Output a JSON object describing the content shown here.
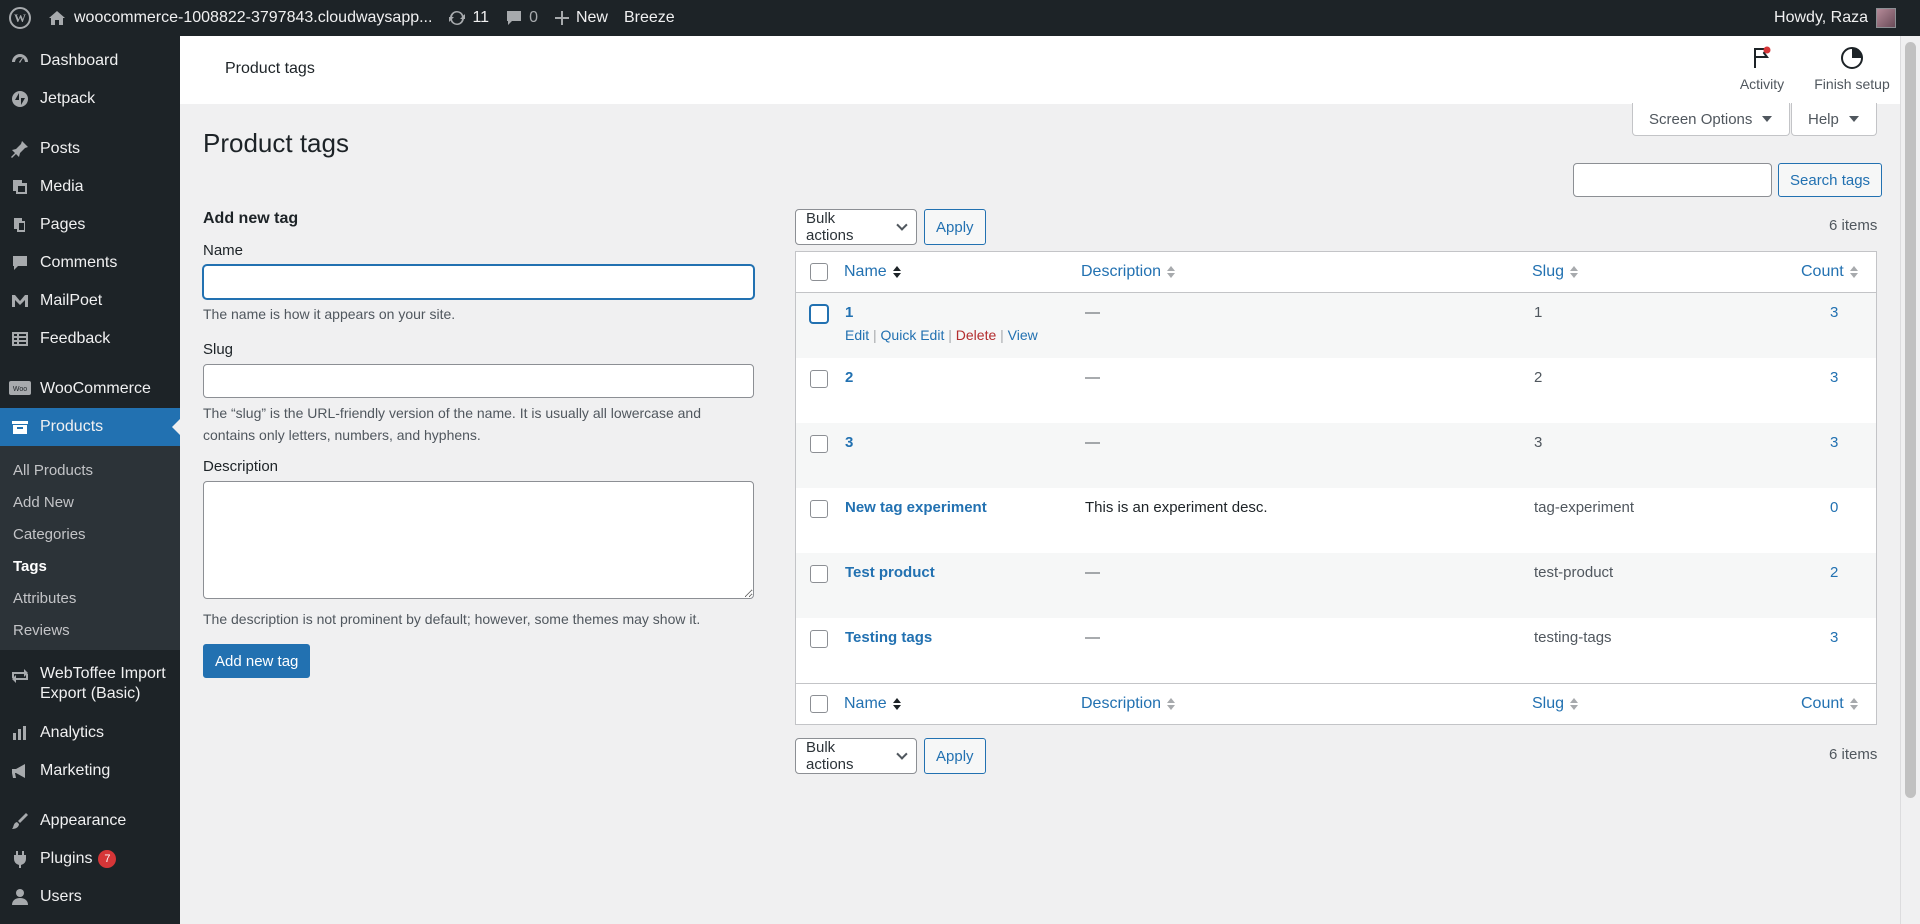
{
  "adminbar": {
    "site_name": "woocommerce-1008822-3797843.cloudwaysapp...",
    "updates_count": "11",
    "comments_count": "0",
    "new_label": "New",
    "breeze_label": "Breeze",
    "howdy": "Howdy, Raza"
  },
  "sidebar": {
    "items_top": [
      {
        "label": "Dashboard",
        "icon": "dashboard-icon"
      },
      {
        "label": "Jetpack",
        "icon": "jetpack-icon"
      }
    ],
    "items_content": [
      {
        "label": "Posts",
        "icon": "posts-icon"
      },
      {
        "label": "Media",
        "icon": "media-icon"
      },
      {
        "label": "Pages",
        "icon": "pages-icon"
      },
      {
        "label": "Comments",
        "icon": "comments-icon"
      },
      {
        "label": "MailPoet",
        "icon": "mailpoet-icon"
      },
      {
        "label": "Feedback",
        "icon": "feedback-icon"
      }
    ],
    "woocommerce": "WooCommerce",
    "products": "Products",
    "submenu": [
      "All Products",
      "Add New",
      "Categories",
      "Tags",
      "Attributes",
      "Reviews"
    ],
    "webtoffee_line1": "WebToffee Import",
    "webtoffee_line2": "Export (Basic)",
    "analytics": "Analytics",
    "marketing": "Marketing",
    "appearance": "Appearance",
    "plugins": "Plugins",
    "plugins_badge": "7",
    "users": "Users"
  },
  "header": {
    "title": "Product tags",
    "activity": "Activity",
    "finish_setup": "Finish setup"
  },
  "screen_options": "Screen Options",
  "help": "Help",
  "page_title": "Product tags",
  "form": {
    "heading": "Add new tag",
    "name_label": "Name",
    "name_help": "The name is how it appears on your site.",
    "slug_label": "Slug",
    "slug_help_1": "The “slug” is the URL-friendly version of the name. It is usually all lowercase and",
    "slug_help_2": "contains only letters, numbers, and hyphens.",
    "desc_label": "Description",
    "desc_help": "The description is not prominent by default; however, some themes may show it.",
    "submit": "Add new tag"
  },
  "search": {
    "button": "Search tags"
  },
  "bulk": {
    "select": "Bulk actions",
    "apply": "Apply",
    "items": "6 items"
  },
  "table": {
    "columns": {
      "name": "Name",
      "description": "Description",
      "slug": "Slug",
      "count": "Count"
    },
    "row_actions": {
      "edit": "Edit",
      "quick_edit": "Quick Edit",
      "delete": "Delete",
      "view": "View"
    },
    "rows": [
      {
        "name": "1",
        "description": "—",
        "slug": "1",
        "count": "3"
      },
      {
        "name": "2",
        "description": "—",
        "slug": "2",
        "count": "3"
      },
      {
        "name": "3",
        "description": "—",
        "slug": "3",
        "count": "3"
      },
      {
        "name": "New tag experiment",
        "description": "This is an experiment desc.",
        "slug": "tag-experiment",
        "count": "0"
      },
      {
        "name": "Test product",
        "description": "—",
        "slug": "test-product",
        "count": "2"
      },
      {
        "name": "Testing tags",
        "description": "—",
        "slug": "testing-tags",
        "count": "3"
      }
    ]
  }
}
